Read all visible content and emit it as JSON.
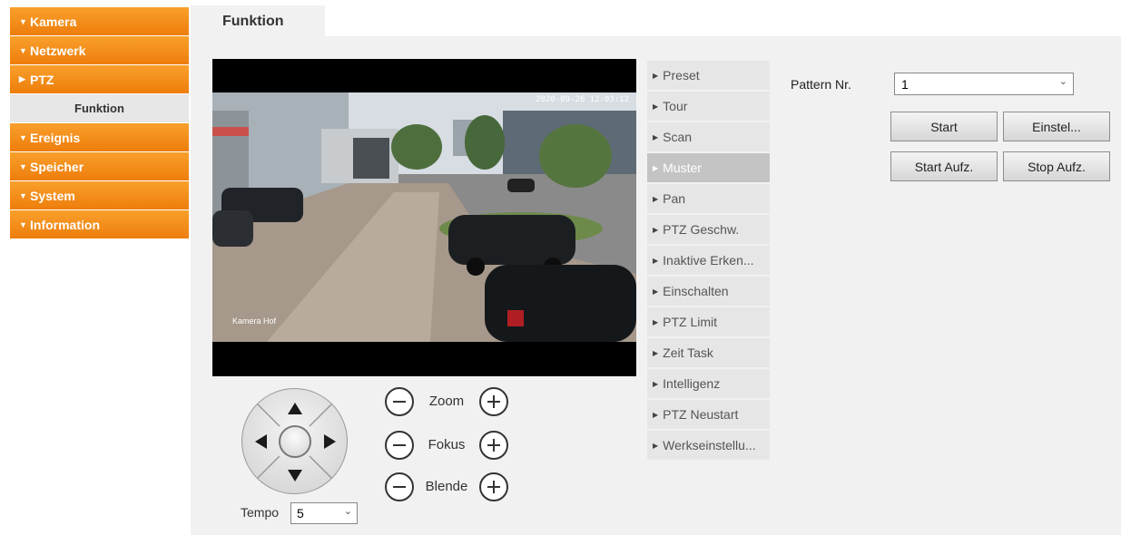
{
  "sidebar": {
    "items": [
      {
        "label": "Kamera",
        "arrow": "▼"
      },
      {
        "label": "Netzwerk",
        "arrow": "▼"
      },
      {
        "label": "PTZ",
        "arrow": "▶"
      },
      {
        "label": "Funktion"
      },
      {
        "label": "Ereignis",
        "arrow": "▼"
      },
      {
        "label": "Speicher",
        "arrow": "▼"
      },
      {
        "label": "System",
        "arrow": "▼"
      },
      {
        "label": "Information",
        "arrow": "▼"
      }
    ]
  },
  "tab": {
    "label": "Funktion"
  },
  "video": {
    "timestamp": "2020-09-26 12:03:12",
    "channel_name": "Kamera Hof"
  },
  "controls": {
    "zoom_label": "Zoom",
    "focus_label": "Fokus",
    "iris_label": "Blende",
    "tempo_label": "Tempo",
    "tempo_value": "5"
  },
  "functions": {
    "items": [
      "Preset",
      "Tour",
      "Scan",
      "Muster",
      "Pan",
      "PTZ Geschw.",
      "Inaktive Erken...",
      "Einschalten",
      "PTZ Limit",
      "Zeit Task",
      "Intelligenz",
      "PTZ Neustart",
      "Werkseinstellu..."
    ],
    "active": "Muster"
  },
  "pattern": {
    "label": "Pattern Nr.",
    "value": "1",
    "start_label": "Start",
    "setup_label": "Einstel...",
    "start_rec_label": "Start Aufz.",
    "stop_rec_label": "Stop Aufz."
  },
  "colors": {
    "nav_orange": "#f08a12",
    "panel_gray": "#f1f1f1",
    "active_item": "#c4c4c4"
  }
}
